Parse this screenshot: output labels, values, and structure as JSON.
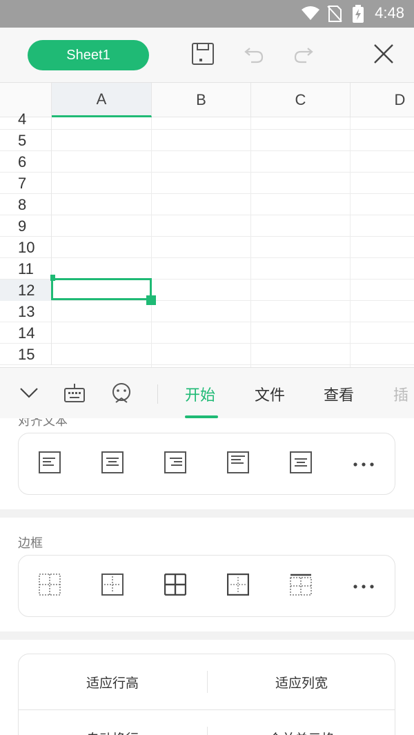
{
  "status_bar": {
    "time": "4:48",
    "icons": [
      "wifi-icon",
      "no-sim-icon",
      "battery-charging-icon"
    ]
  },
  "toolbar": {
    "sheet_name": "Sheet1",
    "icons": [
      "save-icon",
      "undo-icon",
      "redo-icon",
      "close-icon"
    ]
  },
  "grid": {
    "columns": [
      "A",
      "B",
      "C",
      "D"
    ],
    "active_column": "A",
    "rows": [
      "4",
      "5",
      "6",
      "7",
      "8",
      "9",
      "10",
      "11",
      "12",
      "13",
      "14",
      "15"
    ],
    "active_row": "12"
  },
  "tab_bar": {
    "icons": [
      "collapse-chevron-icon",
      "keyboard-icon",
      "emoji-icon"
    ],
    "tabs": [
      {
        "label": "开始",
        "active": true
      },
      {
        "label": "文件",
        "active": false
      },
      {
        "label": "查看",
        "active": false
      },
      {
        "label": "插",
        "active": false
      }
    ]
  },
  "panel": {
    "align_section_label": "对齐文本",
    "align_icons": [
      "align-left-icon",
      "align-center-icon",
      "align-right-icon",
      "align-top-icon",
      "align-middle-icon",
      "more-icon"
    ],
    "border_section_label": "边框",
    "border_icons": [
      "border-none-icon",
      "border-inner-icon",
      "border-all-icon",
      "border-outer-icon",
      "border-top-icon",
      "more-icon"
    ],
    "fit": {
      "row_height": "适应行高",
      "column_width": "适应列宽",
      "wrap_text": "自动换行",
      "merge_cells": "合并单元格"
    }
  },
  "colors": {
    "accent": "#1fba75",
    "status_bar": "#9e9e9e"
  }
}
